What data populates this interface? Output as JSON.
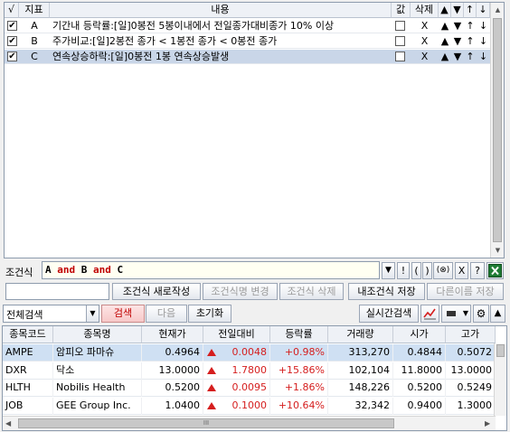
{
  "conditions": {
    "headers": {
      "check": "√",
      "indicator": "지표",
      "content": "내용",
      "value": "값",
      "delete": "삭제",
      "up2": "▲",
      "down2": "▼",
      "up": "↑",
      "down": "↓"
    },
    "rows": [
      {
        "checked": true,
        "indicator": "A",
        "content": "기간내 등락률:[일]0봉전 5봉이내에서 전일종가대비종가 10% 이상",
        "value_checked": false,
        "delete": "X",
        "up2": "▲",
        "down2": "▼",
        "up": "↑",
        "down": "↓"
      },
      {
        "checked": true,
        "indicator": "B",
        "content": "주가비교:[일]2봉전 종가 < 1봉전 종가 < 0봉전 종가",
        "value_checked": false,
        "delete": "X",
        "up2": "▲",
        "down2": "▼",
        "up": "↑",
        "down": "↓"
      },
      {
        "checked": true,
        "indicator": "C",
        "content": "연속상승하락:[일]0봉전 1봉 연속상승발생",
        "value_checked": false,
        "delete": "X",
        "up2": "▲",
        "down2": "▼",
        "up": "↑",
        "down": "↓"
      }
    ]
  },
  "formula": {
    "label": "조건식",
    "tokens": [
      {
        "text": "A",
        "kind": "operand"
      },
      {
        "text": "and",
        "kind": "operator"
      },
      {
        "text": "B",
        "kind": "operand"
      },
      {
        "text": "and",
        "kind": "operator"
      },
      {
        "text": "C",
        "kind": "operand"
      }
    ],
    "buttons": {
      "dropdown": "▼",
      "not": "!",
      "lparen": "(",
      "rparen": ")",
      "clear": "(⊗)",
      "x": "X",
      "help": "?"
    },
    "operator_color": "#c00000"
  },
  "actions": {
    "name_input": "",
    "new": "조건식 새로작성",
    "rename": "조건식명 변경",
    "delete": "조건식 삭제",
    "save": "내조건식 저장",
    "save_as": "다른이름 저장"
  },
  "search": {
    "scope": "전체검색",
    "search": "검색",
    "next": "다음",
    "reset": "초기화",
    "realtime": "실시간검색"
  },
  "results": {
    "headers": [
      "종목코드",
      "종목명",
      "현재가",
      "전일대비",
      "등락률",
      "거래량",
      "시가",
      "고가"
    ],
    "rows": [
      {
        "code": "AMPE",
        "name": "암피오 파마슈",
        "price": "0.4964",
        "change": "0.0048",
        "rate": "+0.98%",
        "volume": "313,270",
        "open": "0.4844",
        "high": "0.5072"
      },
      {
        "code": "DXR",
        "name": "닥소",
        "price": "13.0000",
        "change": "1.7800",
        "rate": "+15.86%",
        "volume": "102,104",
        "open": "11.8000",
        "high": "13.0000"
      },
      {
        "code": "HLTH",
        "name": "Nobilis Health",
        "price": "0.5200",
        "change": "0.0095",
        "rate": "+1.86%",
        "volume": "148,226",
        "open": "0.5200",
        "high": "0.5249"
      },
      {
        "code": "JOB",
        "name": "GEE Group Inc.",
        "price": "1.0400",
        "change": "0.1000",
        "rate": "+10.64%",
        "volume": "32,342",
        "open": "0.9400",
        "high": "1.3000"
      }
    ],
    "hscroll_thumb": "III"
  },
  "colors": {
    "up": "#d51e1e",
    "selection": "#c9d6e8",
    "excel": "#1e7b34"
  }
}
